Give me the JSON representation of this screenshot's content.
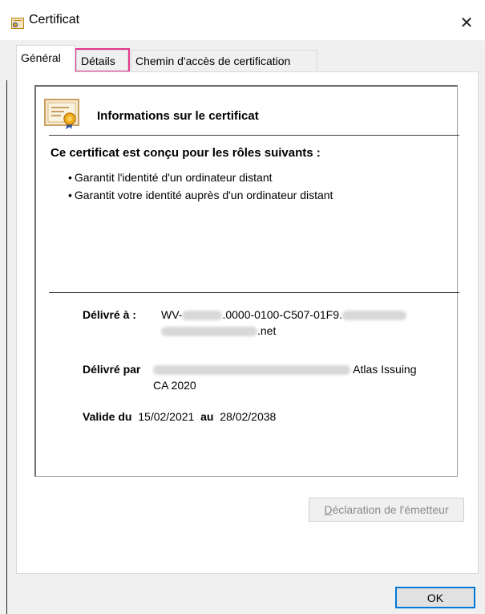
{
  "window": {
    "title": "Certificat",
    "close_glyph": "✕"
  },
  "tabs": [
    {
      "label": "Général",
      "active": true
    },
    {
      "label": "Détails",
      "active": false,
      "highlighted": true
    },
    {
      "label": "Chemin d'accès de certification",
      "active": false
    }
  ],
  "info": {
    "heading": "Informations sur le certificat",
    "purpose_title": "Ce certificat est conçu pour les rôles suivants :",
    "purposes": [
      "Garantit l'identité d'un ordinateur distant",
      "Garantit votre identité auprès d'un ordinateur distant"
    ]
  },
  "issued_to": {
    "label": "Délivré à :",
    "prefix": "WV-",
    "middle": ".0000-0100-C507-01F9.",
    "suffix": ".net"
  },
  "issued_by": {
    "label": "Délivré par",
    "tail": "Atlas Issuing",
    "line2": "CA 2020"
  },
  "validity": {
    "from_label": "Valide du",
    "from_date": "15/02/2021",
    "to_label": "au",
    "to_date": "28/02/2038"
  },
  "buttons": {
    "issuer_statement": "Déclaration de l'émetteur",
    "issuer_mnemonic": "D",
    "issuer_rest": "éclaration de l'émetteur",
    "ok": "OK"
  },
  "colors": {
    "tab_highlight": "#e0398f",
    "ok_border": "#0078d7",
    "disabled_text": "#8a8a8a"
  }
}
